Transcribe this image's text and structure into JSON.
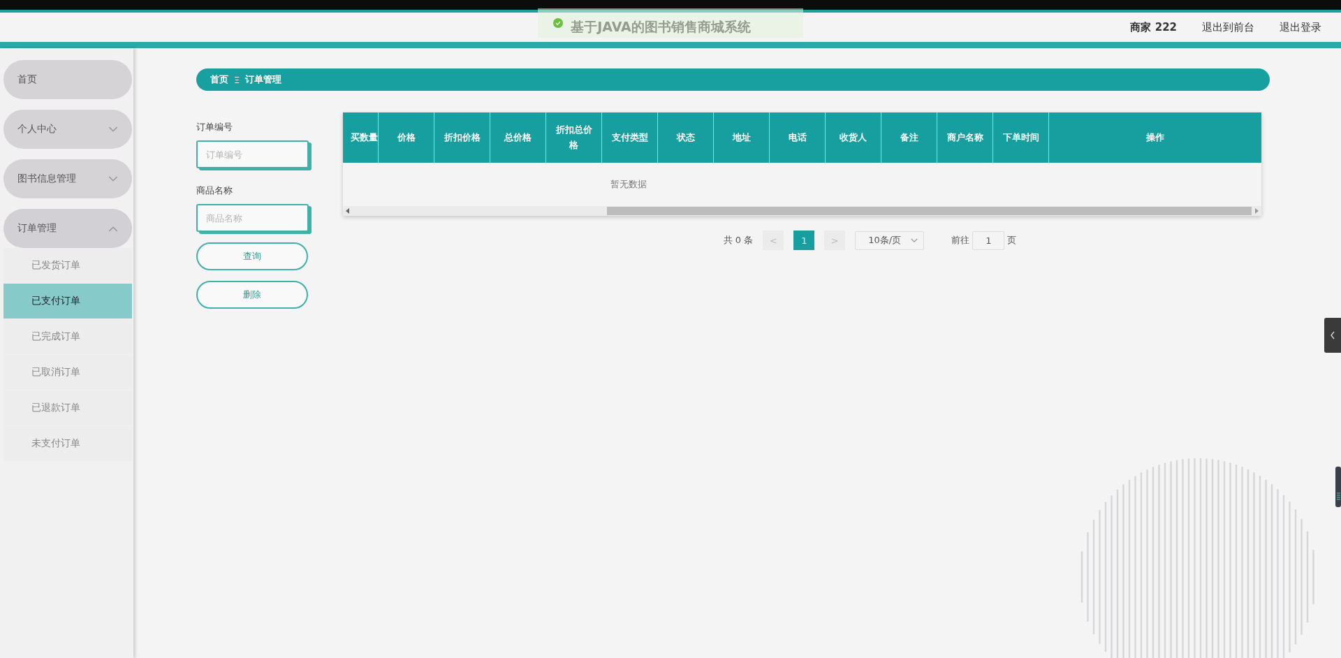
{
  "header": {
    "title": "基于JAVA的图书销售商城系统",
    "user": "商家 222",
    "links": [
      "退出到前台",
      "退出登录"
    ]
  },
  "toast": {
    "kind": "success"
  },
  "sidebar": {
    "items": [
      {
        "label": "首页",
        "kind": "link"
      },
      {
        "label": "个人中心",
        "kind": "group",
        "expanded": false
      },
      {
        "label": "图书信息管理",
        "kind": "group",
        "expanded": false
      },
      {
        "label": "订单管理",
        "kind": "group",
        "expanded": true,
        "children": [
          {
            "label": "已发货订单",
            "selected": false
          },
          {
            "label": "已支付订单",
            "selected": true
          },
          {
            "label": "已完成订单",
            "selected": false
          },
          {
            "label": "已取消订单",
            "selected": false
          },
          {
            "label": "已退款订单",
            "selected": false
          },
          {
            "label": "未支付订单",
            "selected": false
          }
        ]
      }
    ]
  },
  "breadcrumb": {
    "items": [
      "首页",
      "订单管理"
    ],
    "separator": "Ξ"
  },
  "search_form": {
    "fields": [
      {
        "label": "订单编号",
        "placeholder": "订单编号"
      },
      {
        "label": "商品名称",
        "placeholder": "商品名称"
      }
    ],
    "buttons": [
      "查询",
      "删除"
    ]
  },
  "table": {
    "columns": [
      "买数量",
      "价格",
      "折扣价格",
      "总价格",
      "折扣总价格",
      "支付类型",
      "状态",
      "地址",
      "电话",
      "收货人",
      "备注",
      "商户名称",
      "下单时间",
      "操作"
    ],
    "empty_text": "暂无数据"
  },
  "pagination": {
    "total": "共 0 条",
    "prev": "<",
    "pages": [
      {
        "label": "1",
        "selected": true
      }
    ],
    "next": ">",
    "page_size": "10条/页",
    "goto_label": "前往",
    "goto_value": "1",
    "goto_suffix": "页"
  }
}
